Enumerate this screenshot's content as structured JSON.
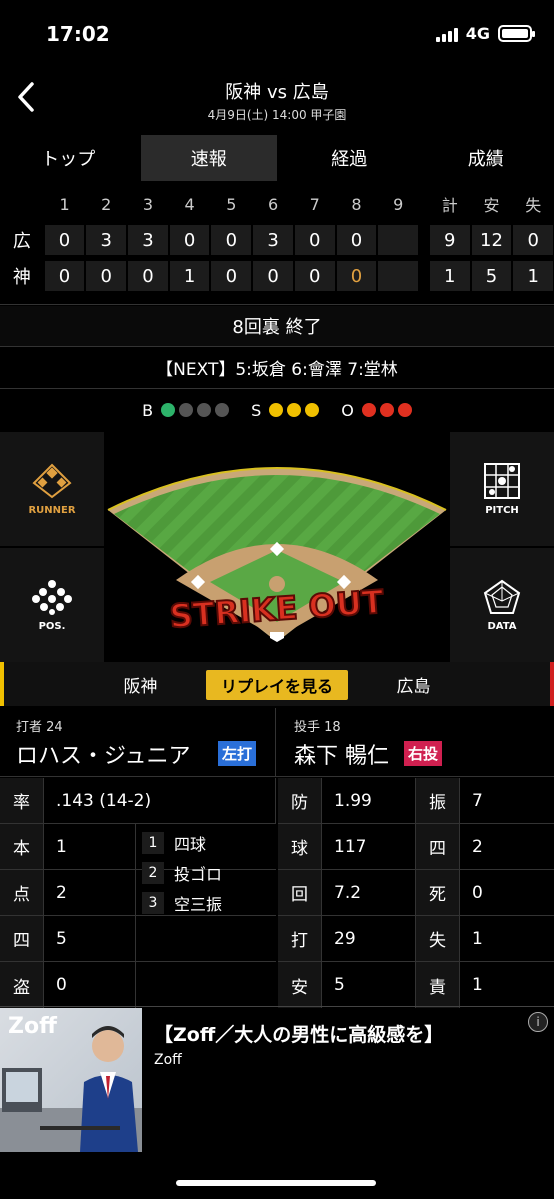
{
  "status": {
    "time": "17:02",
    "network": "4G"
  },
  "header": {
    "title": "阪神 vs 広島",
    "subtitle": "4月9日(土) 14:00 甲子園"
  },
  "tabs": [
    "トップ",
    "速報",
    "経過",
    "成績"
  ],
  "scoreboard": {
    "headers": [
      "1",
      "2",
      "3",
      "4",
      "5",
      "6",
      "7",
      "8",
      "9",
      "計",
      "安",
      "失"
    ],
    "rows": [
      {
        "team": "広",
        "innings": [
          "0",
          "3",
          "3",
          "0",
          "0",
          "3",
          "0",
          "0",
          ""
        ],
        "r": "9",
        "h": "12",
        "e": "0"
      },
      {
        "team": "神",
        "innings": [
          "0",
          "0",
          "0",
          "1",
          "0",
          "0",
          "0",
          "0",
          ""
        ],
        "r": "1",
        "h": "5",
        "e": "1"
      }
    ]
  },
  "inning_status": "8回裏 終了",
  "next": "【NEXT】5:坂倉 6:會澤 7:堂林",
  "count": {
    "b_label": "B",
    "s_label": "S",
    "o_label": "O"
  },
  "colors": {
    "ball": "#2db36a",
    "strike": "#f0c000",
    "out": "#e03020",
    "off": "#555555",
    "accent": "#e8b820"
  },
  "field_buttons": {
    "runner": "RUNNER",
    "pitch": "PITCH",
    "pos": "POS.",
    "data": "DATA"
  },
  "field_overlay": "STRIKE OUT",
  "teambar": {
    "left": "阪神",
    "replay": "リプレイを見る",
    "right": "広島"
  },
  "batter": {
    "role": "打者 24",
    "name": "ロハス・ジュニア",
    "hand": "左打"
  },
  "pitcher": {
    "role": "投手 18",
    "name": "森下 暢仁",
    "hand": "右投"
  },
  "batter_stats": [
    {
      "k": "率",
      "v": ".143 (14-2)"
    },
    {
      "k": "本",
      "v": "1"
    },
    {
      "k": "点",
      "v": "2"
    },
    {
      "k": "四",
      "v": "5"
    },
    {
      "k": "盗",
      "v": "0"
    }
  ],
  "at_bats": [
    {
      "n": "1",
      "r": "四球"
    },
    {
      "n": "2",
      "r": "投ゴロ"
    },
    {
      "n": "3",
      "r": "空三振"
    }
  ],
  "pitcher_stats": [
    {
      "k1": "防",
      "v1": "1.99",
      "k2": "振",
      "v2": "7"
    },
    {
      "k1": "球",
      "v1": "117",
      "k2": "四",
      "v2": "2"
    },
    {
      "k1": "回",
      "v1": "7.2",
      "k2": "死",
      "v2": "0"
    },
    {
      "k1": "打",
      "v1": "29",
      "k2": "失",
      "v2": "1"
    },
    {
      "k1": "安",
      "v1": "5",
      "k2": "責",
      "v2": "1"
    }
  ],
  "ad": {
    "logo": "Zoff",
    "title": "【Zoff／大人の男性に高級感を】",
    "brand": "Zoff",
    "info_icon": "i"
  }
}
